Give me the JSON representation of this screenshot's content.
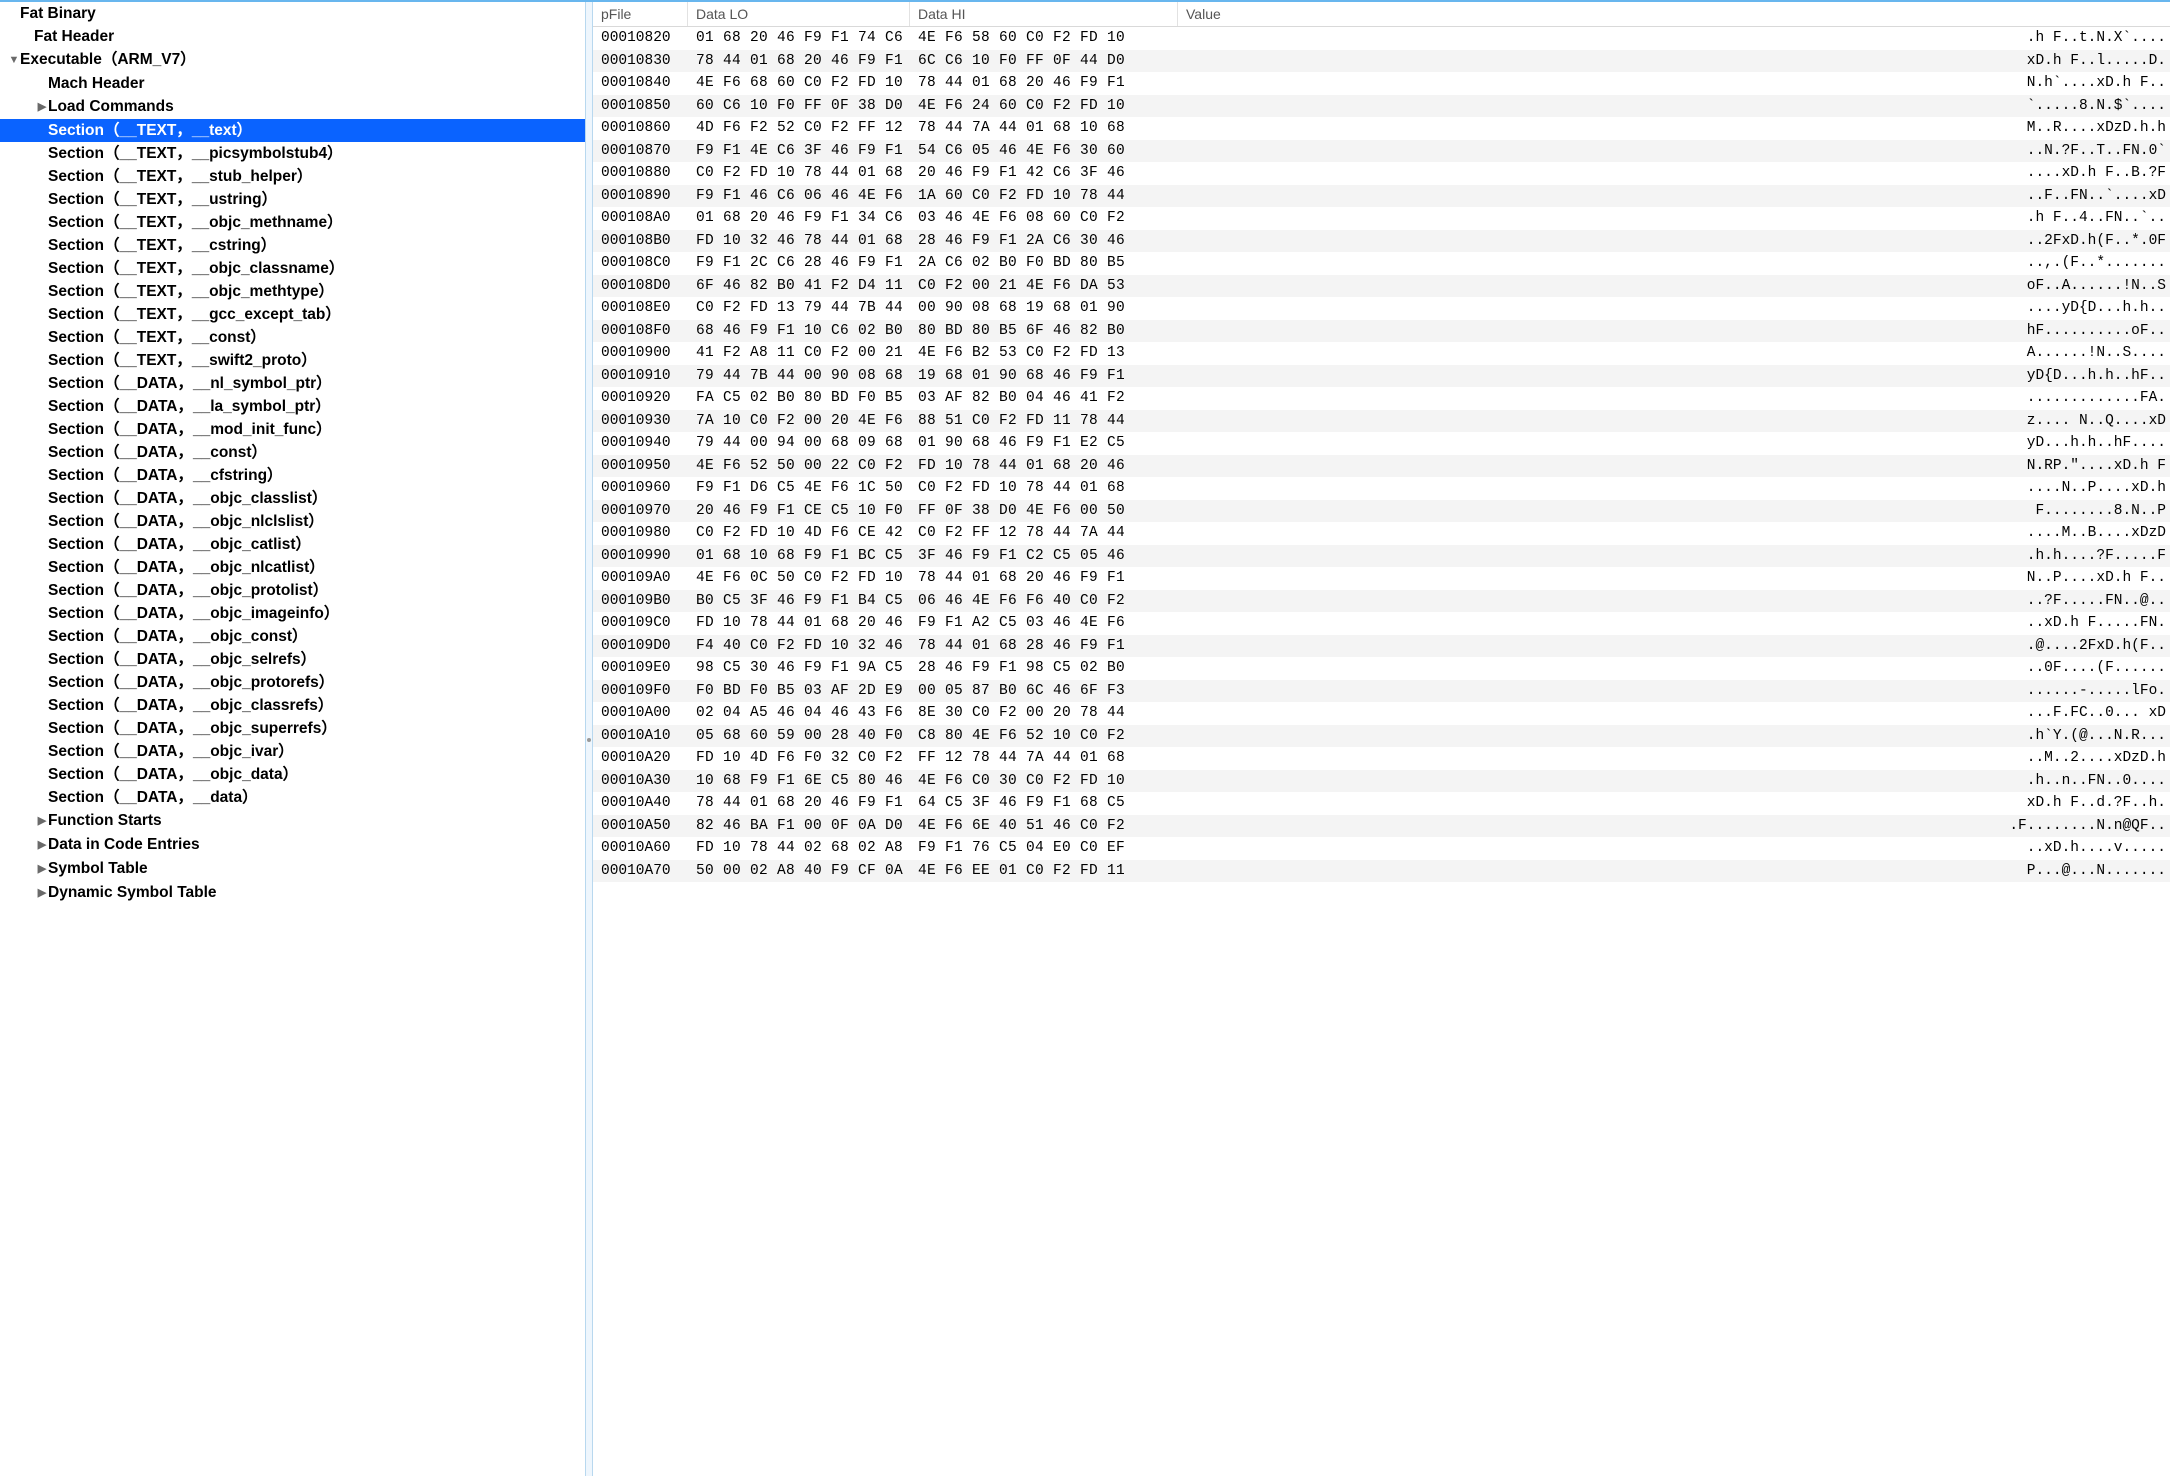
{
  "columns": {
    "pfile": "pFile",
    "dataLo": "Data LO",
    "dataHi": "Data HI",
    "value": "Value"
  },
  "tree": [
    {
      "label": "Fat Binary",
      "depth": 0,
      "arrow": ""
    },
    {
      "label": "Fat Header",
      "depth": 1,
      "arrow": ""
    },
    {
      "label": "Executable（ARM_V7）",
      "depth": 0,
      "arrow": "▼"
    },
    {
      "label": "Mach Header",
      "depth": 2,
      "arrow": ""
    },
    {
      "label": "Load Commands",
      "depth": 2,
      "arrow": "▶"
    },
    {
      "label": "Section（__TEXT，__text）",
      "depth": 2,
      "arrow": "",
      "selected": true
    },
    {
      "label": "Section（__TEXT，__picsymbolstub4）",
      "depth": 2,
      "arrow": ""
    },
    {
      "label": "Section（__TEXT，__stub_helper）",
      "depth": 2,
      "arrow": ""
    },
    {
      "label": "Section（__TEXT，__ustring）",
      "depth": 2,
      "arrow": ""
    },
    {
      "label": "Section（__TEXT，__objc_methname）",
      "depth": 2,
      "arrow": ""
    },
    {
      "label": "Section（__TEXT，__cstring）",
      "depth": 2,
      "arrow": ""
    },
    {
      "label": "Section（__TEXT，__objc_classname）",
      "depth": 2,
      "arrow": ""
    },
    {
      "label": "Section（__TEXT，__objc_methtype）",
      "depth": 2,
      "arrow": ""
    },
    {
      "label": "Section（__TEXT，__gcc_except_tab）",
      "depth": 2,
      "arrow": ""
    },
    {
      "label": "Section（__TEXT，__const）",
      "depth": 2,
      "arrow": ""
    },
    {
      "label": "Section（__TEXT，__swift2_proto）",
      "depth": 2,
      "arrow": ""
    },
    {
      "label": "Section（__DATA，__nl_symbol_ptr）",
      "depth": 2,
      "arrow": ""
    },
    {
      "label": "Section（__DATA，__la_symbol_ptr）",
      "depth": 2,
      "arrow": ""
    },
    {
      "label": "Section（__DATA，__mod_init_func）",
      "depth": 2,
      "arrow": ""
    },
    {
      "label": "Section（__DATA，__const）",
      "depth": 2,
      "arrow": ""
    },
    {
      "label": "Section（__DATA，__cfstring）",
      "depth": 2,
      "arrow": ""
    },
    {
      "label": "Section（__DATA，__objc_classlist）",
      "depth": 2,
      "arrow": ""
    },
    {
      "label": "Section（__DATA，__objc_nlclslist）",
      "depth": 2,
      "arrow": ""
    },
    {
      "label": "Section（__DATA，__objc_catlist）",
      "depth": 2,
      "arrow": ""
    },
    {
      "label": "Section（__DATA，__objc_nlcatlist）",
      "depth": 2,
      "arrow": ""
    },
    {
      "label": "Section（__DATA，__objc_protolist）",
      "depth": 2,
      "arrow": ""
    },
    {
      "label": "Section（__DATA，__objc_imageinfo）",
      "depth": 2,
      "arrow": ""
    },
    {
      "label": "Section（__DATA，__objc_const）",
      "depth": 2,
      "arrow": ""
    },
    {
      "label": "Section（__DATA，__objc_selrefs）",
      "depth": 2,
      "arrow": ""
    },
    {
      "label": "Section（__DATA，__objc_protorefs）",
      "depth": 2,
      "arrow": ""
    },
    {
      "label": "Section（__DATA，__objc_classrefs）",
      "depth": 2,
      "arrow": ""
    },
    {
      "label": "Section（__DATA，__objc_superrefs）",
      "depth": 2,
      "arrow": ""
    },
    {
      "label": "Section（__DATA，__objc_ivar）",
      "depth": 2,
      "arrow": ""
    },
    {
      "label": "Section（__DATA，__objc_data）",
      "depth": 2,
      "arrow": ""
    },
    {
      "label": "Section（__DATA，__data）",
      "depth": 2,
      "arrow": ""
    },
    {
      "label": "Function Starts",
      "depth": 2,
      "arrow": "▶"
    },
    {
      "label": "Data in Code Entries",
      "depth": 2,
      "arrow": "▶"
    },
    {
      "label": "Symbol Table",
      "depth": 2,
      "arrow": "▶"
    },
    {
      "label": "Dynamic Symbol Table",
      "depth": 2,
      "arrow": "▶"
    }
  ],
  "hex": [
    {
      "addr": "00010820",
      "lo": "01 68 20 46 F9 F1 74 C6",
      "hi": "4E F6 58 60 C0 F2 FD 10",
      "val": ".h F..t.N.X`...."
    },
    {
      "addr": "00010830",
      "lo": "78 44 01 68 20 46 F9 F1",
      "hi": "6C C6 10 F0 FF 0F 44 D0",
      "val": "xD.h F..l.....D."
    },
    {
      "addr": "00010840",
      "lo": "4E F6 68 60 C0 F2 FD 10",
      "hi": "78 44 01 68 20 46 F9 F1",
      "val": "N.h`....xD.h F.."
    },
    {
      "addr": "00010850",
      "lo": "60 C6 10 F0 FF 0F 38 D0",
      "hi": "4E F6 24 60 C0 F2 FD 10",
      "val": "`.....8.N.$`...."
    },
    {
      "addr": "00010860",
      "lo": "4D F6 F2 52 C0 F2 FF 12",
      "hi": "78 44 7A 44 01 68 10 68",
      "val": "M..R....xDzD.h.h"
    },
    {
      "addr": "00010870",
      "lo": "F9 F1 4E C6 3F 46 F9 F1",
      "hi": "54 C6 05 46 4E F6 30 60",
      "val": "..N.?F..T..FN.0`"
    },
    {
      "addr": "00010880",
      "lo": "C0 F2 FD 10 78 44 01 68",
      "hi": "20 46 F9 F1 42 C6 3F 46",
      "val": "....xD.h F..B.?F"
    },
    {
      "addr": "00010890",
      "lo": "F9 F1 46 C6 06 46 4E F6",
      "hi": "1A 60 C0 F2 FD 10 78 44",
      "val": "..F..FN..`....xD"
    },
    {
      "addr": "000108A0",
      "lo": "01 68 20 46 F9 F1 34 C6",
      "hi": "03 46 4E F6 08 60 C0 F2",
      "val": ".h F..4..FN..`.."
    },
    {
      "addr": "000108B0",
      "lo": "FD 10 32 46 78 44 01 68",
      "hi": "28 46 F9 F1 2A C6 30 46",
      "val": "..2FxD.h(F..*.0F"
    },
    {
      "addr": "000108C0",
      "lo": "F9 F1 2C C6 28 46 F9 F1",
      "hi": "2A C6 02 B0 F0 BD 80 B5",
      "val": "..,.(F..*......."
    },
    {
      "addr": "000108D0",
      "lo": "6F 46 82 B0 41 F2 D4 11",
      "hi": "C0 F2 00 21 4E F6 DA 53",
      "val": "oF..A......!N..S"
    },
    {
      "addr": "000108E0",
      "lo": "C0 F2 FD 13 79 44 7B 44",
      "hi": "00 90 08 68 19 68 01 90",
      "val": "....yD{D...h.h.."
    },
    {
      "addr": "000108F0",
      "lo": "68 46 F9 F1 10 C6 02 B0",
      "hi": "80 BD 80 B5 6F 46 82 B0",
      "val": "hF..........oF.."
    },
    {
      "addr": "00010900",
      "lo": "41 F2 A8 11 C0 F2 00 21",
      "hi": "4E F6 B2 53 C0 F2 FD 13",
      "val": "A......!N..S...."
    },
    {
      "addr": "00010910",
      "lo": "79 44 7B 44 00 90 08 68",
      "hi": "19 68 01 90 68 46 F9 F1",
      "val": "yD{D...h.h..hF.."
    },
    {
      "addr": "00010920",
      "lo": "FA C5 02 B0 80 BD F0 B5",
      "hi": "03 AF 82 B0 04 46 41 F2",
      "val": ".............FA."
    },
    {
      "addr": "00010930",
      "lo": "7A 10 C0 F2 00 20 4E F6",
      "hi": "88 51 C0 F2 FD 11 78 44",
      "val": "z.... N..Q....xD"
    },
    {
      "addr": "00010940",
      "lo": "79 44 00 94 00 68 09 68",
      "hi": "01 90 68 46 F9 F1 E2 C5",
      "val": "yD...h.h..hF...."
    },
    {
      "addr": "00010950",
      "lo": "4E F6 52 50 00 22 C0 F2",
      "hi": "FD 10 78 44 01 68 20 46",
      "val": "N.RP.\"....xD.h F"
    },
    {
      "addr": "00010960",
      "lo": "F9 F1 D6 C5 4E F6 1C 50",
      "hi": "C0 F2 FD 10 78 44 01 68",
      "val": "....N..P....xD.h"
    },
    {
      "addr": "00010970",
      "lo": "20 46 F9 F1 CE C5 10 F0",
      "hi": "FF 0F 38 D0 4E F6 00 50",
      "val": " F........8.N..P"
    },
    {
      "addr": "00010980",
      "lo": "C0 F2 FD 10 4D F6 CE 42",
      "hi": "C0 F2 FF 12 78 44 7A 44",
      "val": "....M..B....xDzD"
    },
    {
      "addr": "00010990",
      "lo": "01 68 10 68 F9 F1 BC C5",
      "hi": "3F 46 F9 F1 C2 C5 05 46",
      "val": ".h.h....?F.....F"
    },
    {
      "addr": "000109A0",
      "lo": "4E F6 0C 50 C0 F2 FD 10",
      "hi": "78 44 01 68 20 46 F9 F1",
      "val": "N..P....xD.h F.."
    },
    {
      "addr": "000109B0",
      "lo": "B0 C5 3F 46 F9 F1 B4 C5",
      "hi": "06 46 4E F6 F6 40 C0 F2",
      "val": "..?F.....FN..@.."
    },
    {
      "addr": "000109C0",
      "lo": "FD 10 78 44 01 68 20 46",
      "hi": "F9 F1 A2 C5 03 46 4E F6",
      "val": "..xD.h F.....FN."
    },
    {
      "addr": "000109D0",
      "lo": "F4 40 C0 F2 FD 10 32 46",
      "hi": "78 44 01 68 28 46 F9 F1",
      "val": ".@....2FxD.h(F.."
    },
    {
      "addr": "000109E0",
      "lo": "98 C5 30 46 F9 F1 9A C5",
      "hi": "28 46 F9 F1 98 C5 02 B0",
      "val": "..0F....(F......"
    },
    {
      "addr": "000109F0",
      "lo": "F0 BD F0 B5 03 AF 2D E9",
      "hi": "00 05 87 B0 6C 46 6F F3",
      "val": "......-.....lFo."
    },
    {
      "addr": "00010A00",
      "lo": "02 04 A5 46 04 46 43 F6",
      "hi": "8E 30 C0 F2 00 20 78 44",
      "val": "...F.FC..0... xD"
    },
    {
      "addr": "00010A10",
      "lo": "05 68 60 59 00 28 40 F0",
      "hi": "C8 80 4E F6 52 10 C0 F2",
      "val": ".h`Y.(@...N.R..."
    },
    {
      "addr": "00010A20",
      "lo": "FD 10 4D F6 F0 32 C0 F2",
      "hi": "FF 12 78 44 7A 44 01 68",
      "val": "..M..2....xDzD.h"
    },
    {
      "addr": "00010A30",
      "lo": "10 68 F9 F1 6E C5 80 46",
      "hi": "4E F6 C0 30 C0 F2 FD 10",
      "val": ".h..n..FN..0...."
    },
    {
      "addr": "00010A40",
      "lo": "78 44 01 68 20 46 F9 F1",
      "hi": "64 C5 3F 46 F9 F1 68 C5",
      "val": "xD.h F..d.?F..h."
    },
    {
      "addr": "00010A50",
      "lo": "82 46 BA F1 00 0F 0A D0",
      "hi": "4E F6 6E 40 51 46 C0 F2",
      "val": ".F........N.n@QF.."
    },
    {
      "addr": "00010A60",
      "lo": "FD 10 78 44 02 68 02 A8",
      "hi": "F9 F1 76 C5 04 E0 C0 EF",
      "val": "..xD.h....v....."
    },
    {
      "addr": "00010A70",
      "lo": "50 00 02 A8 40 F9 CF 0A",
      "hi": "4E F6 EE 01 C0 F2 FD 11",
      "val": "P...@...N......."
    }
  ]
}
